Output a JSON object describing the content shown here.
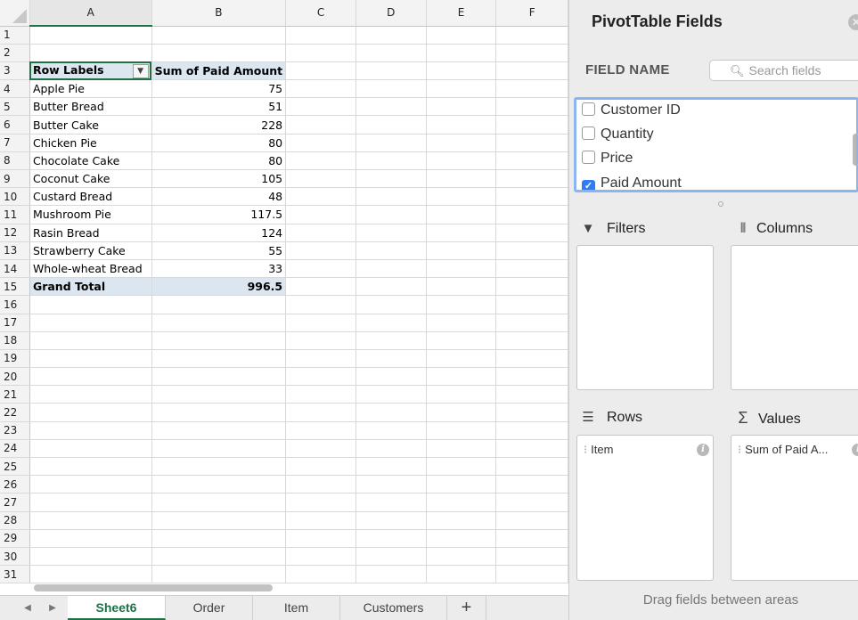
{
  "sheet": {
    "columns": [
      "A",
      "B",
      "C",
      "D",
      "E",
      "F"
    ],
    "rows": [
      {
        "n": "1",
        "a": "",
        "b": ""
      },
      {
        "n": "2",
        "a": "",
        "b": ""
      },
      {
        "n": "3",
        "a": "Row Labels",
        "b": "Sum of Paid Amount"
      },
      {
        "n": "4",
        "a": "Apple Pie",
        "b": "75"
      },
      {
        "n": "5",
        "a": "Butter Bread",
        "b": "51"
      },
      {
        "n": "6",
        "a": "Butter Cake",
        "b": "228"
      },
      {
        "n": "7",
        "a": "Chicken Pie",
        "b": "80"
      },
      {
        "n": "8",
        "a": "Chocolate Cake",
        "b": "80"
      },
      {
        "n": "9",
        "a": "Coconut Cake",
        "b": "105"
      },
      {
        "n": "10",
        "a": "Custard Bread",
        "b": "48"
      },
      {
        "n": "11",
        "a": "Mushroom Pie",
        "b": "117.5"
      },
      {
        "n": "12",
        "a": "Rasin Bread",
        "b": "124"
      },
      {
        "n": "13",
        "a": "Strawberry Cake",
        "b": "55"
      },
      {
        "n": "14",
        "a": "Whole-wheat Bread",
        "b": "33"
      },
      {
        "n": "15",
        "a": "Grand Total",
        "b": "996.5"
      },
      {
        "n": "16",
        "a": "",
        "b": ""
      },
      {
        "n": "17",
        "a": "",
        "b": ""
      },
      {
        "n": "18",
        "a": "",
        "b": ""
      },
      {
        "n": "19",
        "a": "",
        "b": ""
      },
      {
        "n": "20",
        "a": "",
        "b": ""
      },
      {
        "n": "21",
        "a": "",
        "b": ""
      },
      {
        "n": "22",
        "a": "",
        "b": ""
      },
      {
        "n": "23",
        "a": "",
        "b": ""
      },
      {
        "n": "24",
        "a": "",
        "b": ""
      },
      {
        "n": "25",
        "a": "",
        "b": ""
      },
      {
        "n": "26",
        "a": "",
        "b": ""
      },
      {
        "n": "27",
        "a": "",
        "b": ""
      },
      {
        "n": "28",
        "a": "",
        "b": ""
      },
      {
        "n": "29",
        "a": "",
        "b": ""
      },
      {
        "n": "30",
        "a": "",
        "b": ""
      },
      {
        "n": "31",
        "a": "",
        "b": ""
      }
    ],
    "active_cell": "A3",
    "accent_color": "#1e7145",
    "pivot_fill_color": "#dce6f1"
  },
  "tabs": {
    "prev_icon": "triangle-left-icon",
    "next_icon": "triangle-right-icon",
    "items": [
      {
        "label": "Sheet6",
        "active": true
      },
      {
        "label": "Order",
        "active": false
      },
      {
        "label": "Item",
        "active": false
      },
      {
        "label": "Customers",
        "active": false
      }
    ],
    "add_label": "+"
  },
  "pivot_pane": {
    "title": "PivotTable Fields",
    "close_icon": "close-icon",
    "field_name_label": "FIELD NAME",
    "search_placeholder": "Search fields",
    "search_icon": "magnifier-icon",
    "fields": [
      {
        "label": "Customer ID",
        "checked": false
      },
      {
        "label": "Quantity",
        "checked": false
      },
      {
        "label": "Price",
        "checked": false
      },
      {
        "label": "Paid Amount",
        "checked": true
      }
    ],
    "areas": {
      "filters": {
        "label": "Filters",
        "icon": "funnel-icon",
        "items": []
      },
      "columns": {
        "label": "Columns",
        "icon": "columns-icon",
        "items": []
      },
      "rows": {
        "label": "Rows",
        "icon": "rows-icon",
        "items": [
          "Item"
        ]
      },
      "values": {
        "label": "Values",
        "icon": "sigma-icon",
        "items": [
          "Sum of Paid A..."
        ]
      }
    },
    "drag_hint": "Drag fields between areas",
    "focus_color": "#8cb5f0",
    "check_color": "#2f7cf6"
  }
}
